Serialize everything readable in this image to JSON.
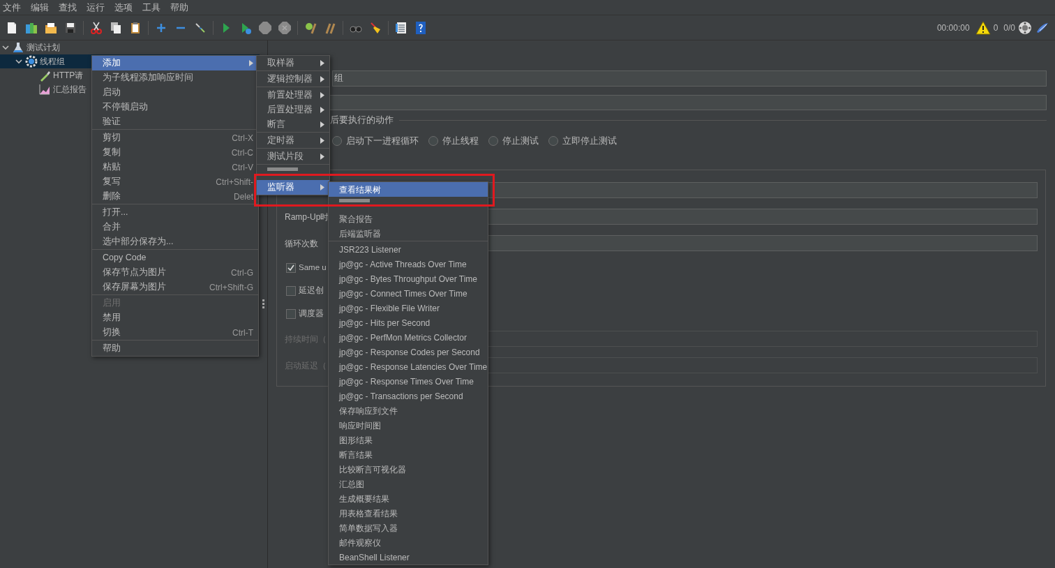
{
  "menu_bar": [
    "文件",
    "编辑",
    "查找",
    "运行",
    "选项",
    "工具",
    "帮助"
  ],
  "status": {
    "elapsed": "00:00:00",
    "warnings": "0",
    "threads": "0/0"
  },
  "tree": [
    {
      "label": "测试计划",
      "kind": "plan",
      "expanded": true,
      "selected": false,
      "children": [
        {
          "label": "线程组",
          "kind": "group",
          "expanded": true,
          "selected": true,
          "children": [
            {
              "label": "HTTP请",
              "kind": "sampler",
              "selected": false
            },
            {
              "label": "汇总报告",
              "kind": "report",
              "selected": false
            }
          ]
        }
      ]
    }
  ],
  "form": {
    "name_value": "组",
    "action_legend": "后要执行的动作",
    "actions": [
      {
        "label": "启动下一进程循环",
        "selected": false
      },
      {
        "label": "停止线程",
        "selected": false
      },
      {
        "label": "停止测试",
        "selected": false
      },
      {
        "label": "立即停止测试",
        "selected": false
      }
    ],
    "properties": [
      {
        "kind": "field",
        "disabled": false
      },
      {
        "kind": "field",
        "label": "Ramp-Up时",
        "disabled": false
      },
      {
        "kind": "field",
        "label": "循环次数",
        "disabled": false
      },
      {
        "kind": "check",
        "label": "Same u",
        "checked": true
      },
      {
        "kind": "check",
        "label": "延迟创",
        "checked": false
      },
      {
        "kind": "check",
        "label": "调度器",
        "checked": false
      },
      {
        "kind": "field",
        "label": "持续时间（",
        "disabled": true
      },
      {
        "kind": "field",
        "label": "启动延迟（",
        "disabled": true
      }
    ]
  },
  "context_menu": [
    [
      {
        "label": "添加",
        "submenu": true,
        "disabled": false,
        "selected": true
      },
      {
        "label": "为子线程添加响应时间",
        "disabled": false,
        "selected": false
      },
      {
        "label": "启动",
        "disabled": false,
        "selected": false
      },
      {
        "label": "不停顿启动",
        "disabled": false,
        "selected": false
      },
      {
        "label": "验证",
        "disabled": false,
        "selected": false
      }
    ],
    [
      {
        "label": "剪切",
        "shortcut": "Ctrl-X",
        "disabled": false,
        "selected": false
      },
      {
        "label": "复制",
        "shortcut": "Ctrl-C",
        "disabled": false,
        "selected": false
      },
      {
        "label": "粘贴",
        "shortcut": "Ctrl-V",
        "disabled": false,
        "selected": false
      },
      {
        "label": "复写",
        "shortcut": "Ctrl+Shift-",
        "disabled": false,
        "selected": false
      },
      {
        "label": "删除",
        "shortcut": "Delet",
        "disabled": false,
        "selected": false
      }
    ],
    [
      {
        "label": "打开...",
        "disabled": false,
        "selected": false
      },
      {
        "label": "合并",
        "disabled": false,
        "selected": false
      },
      {
        "label": "选中部分保存为...",
        "disabled": false,
        "selected": false
      }
    ],
    [
      {
        "label": "Copy Code",
        "disabled": false,
        "selected": false
      },
      {
        "label": "保存节点为图片",
        "shortcut": "Ctrl-G",
        "disabled": false,
        "selected": false
      },
      {
        "label": "保存屏幕为图片",
        "shortcut": "Ctrl+Shift-G",
        "disabled": false,
        "selected": false
      }
    ],
    [
      {
        "label": "启用",
        "disabled": true,
        "selected": false
      },
      {
        "label": "禁用",
        "disabled": false,
        "selected": false
      },
      {
        "label": "切换",
        "shortcut": "Ctrl-T",
        "disabled": false,
        "selected": false
      }
    ],
    [
      {
        "label": "帮助",
        "disabled": false,
        "selected": false
      }
    ]
  ],
  "add_menu": [
    [
      {
        "label": "取样器",
        "submenu": true,
        "selected": false
      }
    ],
    [
      {
        "label": "逻辑控制器",
        "submenu": true,
        "selected": false
      }
    ],
    [
      {
        "label": "前置处理器",
        "submenu": true,
        "selected": false
      },
      {
        "label": "后置处理器",
        "submenu": true,
        "selected": false
      },
      {
        "label": "断言",
        "submenu": true,
        "selected": false
      }
    ],
    [
      {
        "label": "定时器",
        "submenu": true,
        "selected": false
      }
    ],
    [
      {
        "label": "测试片段",
        "submenu": true,
        "selected": false
      }
    ],
    [
      {
        "kind": "covered"
      },
      {
        "label": "监听器",
        "submenu": true,
        "selected": true
      }
    ]
  ],
  "listener_menu": [
    [
      {
        "label": "查看结果树",
        "selected": true
      },
      {
        "kind": "covered"
      },
      {
        "label": "聚合报告",
        "selected": false
      },
      {
        "label": "后端监听器",
        "selected": false
      }
    ],
    [
      {
        "label": "JSR223 Listener",
        "selected": false
      },
      {
        "label": "jp@gc - Active Threads Over Time",
        "selected": false
      },
      {
        "label": "jp@gc - Bytes Throughput Over Time",
        "selected": false
      },
      {
        "label": "jp@gc - Connect Times Over Time",
        "selected": false
      },
      {
        "label": "jp@gc - Flexible File Writer",
        "selected": false
      },
      {
        "label": "jp@gc - Hits per Second",
        "selected": false
      },
      {
        "label": "jp@gc - PerfMon Metrics Collector",
        "selected": false
      },
      {
        "label": "jp@gc - Response Codes per Second",
        "selected": false
      },
      {
        "label": "jp@gc - Response Latencies Over Time",
        "selected": false
      },
      {
        "label": "jp@gc - Response Times Over Time",
        "selected": false
      },
      {
        "label": "jp@gc - Transactions per Second",
        "selected": false
      },
      {
        "label": "保存响应到文件",
        "selected": false
      },
      {
        "label": "响应时间图",
        "selected": false
      },
      {
        "label": "图形结果",
        "selected": false
      },
      {
        "label": "断言结果",
        "selected": false
      },
      {
        "label": "比较断言可视化器",
        "selected": false
      },
      {
        "label": "汇总图",
        "selected": false
      },
      {
        "label": "生成概要结果",
        "selected": false
      },
      {
        "label": "用表格查看结果",
        "selected": false
      },
      {
        "label": "简单数据写入器",
        "selected": false
      },
      {
        "label": "邮件观察仪",
        "selected": false
      },
      {
        "label": "BeanShell Listener",
        "selected": false
      }
    ]
  ]
}
